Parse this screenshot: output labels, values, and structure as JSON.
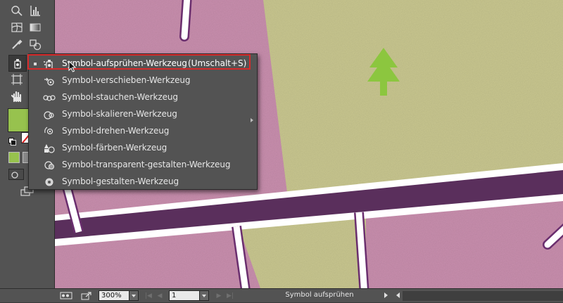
{
  "flyout": {
    "items": [
      {
        "label": "Symbol-aufsprühen-Werkzeug",
        "shortcut": "(Umschalt+S)",
        "icon": "symbol-sprayer-icon",
        "active": true
      },
      {
        "label": "Symbol-verschieben-Werkzeug",
        "icon": "symbol-shifter-icon"
      },
      {
        "label": "Symbol-stauchen-Werkzeug",
        "icon": "symbol-scruncher-icon"
      },
      {
        "label": "Symbol-skalieren-Werkzeug",
        "icon": "symbol-sizer-icon"
      },
      {
        "label": "Symbol-drehen-Werkzeug",
        "icon": "symbol-spinner-icon"
      },
      {
        "label": "Symbol-färben-Werkzeug",
        "icon": "symbol-stainer-icon"
      },
      {
        "label": "Symbol-transparent-gestalten-Werkzeug",
        "icon": "symbol-screener-icon"
      },
      {
        "label": "Symbol-gestalten-Werkzeug",
        "icon": "symbol-styler-icon"
      }
    ]
  },
  "statusbar": {
    "zoom": "300%",
    "artboard": "1",
    "tool_name": "Symbol aufsprühen"
  },
  "colors": {
    "pink": "#c98fae",
    "green_bg": "#c9c790",
    "purple": "#5a2f5c",
    "tree": "#8cc63f",
    "fill_swatch": "#97c24e",
    "highlight": "#d62a2a"
  },
  "toolbar": {
    "icons": [
      "shape-builder-icon",
      "graph-icon",
      "mesh-icon",
      "gradient-icon",
      "eyedropper-icon",
      "blend-icon",
      "symbol-sprayer-icon",
      "artboard-icon",
      "hand-icon",
      "zoom-icon",
      "fill-swatch",
      "stroke-swatch",
      "swap-icon",
      "default-colors-icon",
      "color-mode-icon",
      "draw-mode-icon",
      "screen-mode-icon"
    ]
  }
}
